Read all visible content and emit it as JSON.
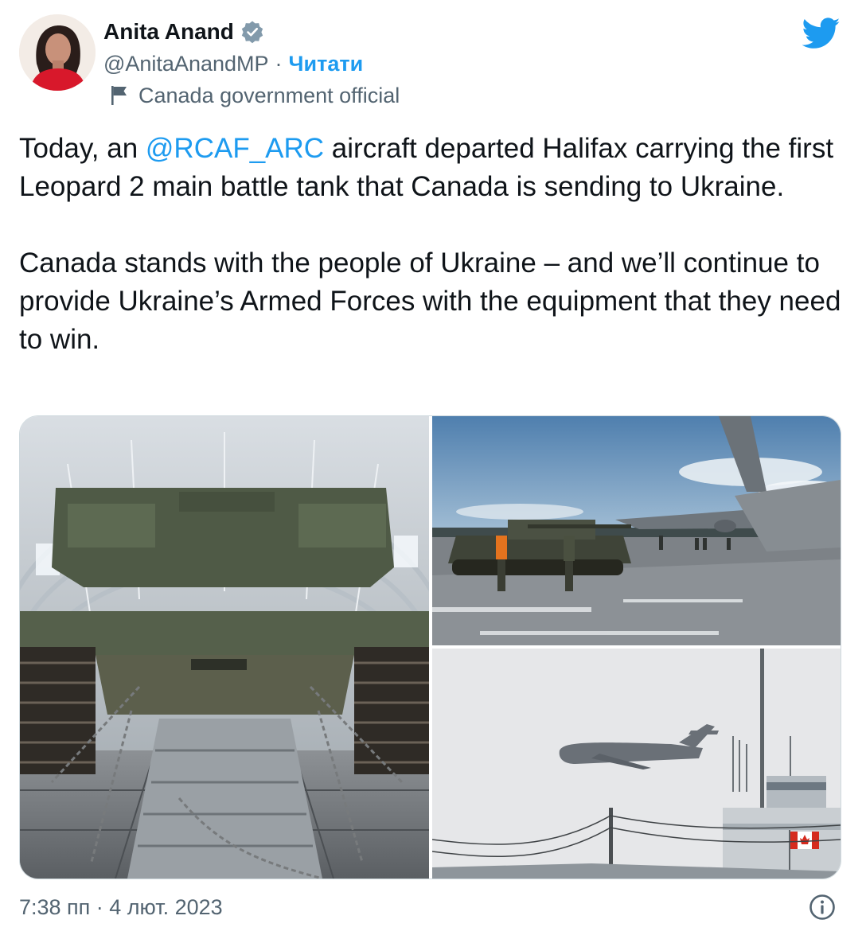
{
  "author": {
    "display_name": "Anita Anand",
    "handle": "@AnitaAnandMP",
    "separator": "·",
    "follow_label": "Читати",
    "label": "Canada government official",
    "verified": true
  },
  "tweet": {
    "paragraphs": [
      {
        "before": "Today, an ",
        "mention": "@RCAF_ARC",
        "after": " aircraft departed Halifax carrying the first Leopard 2 main battle tank that Canada is sending to Ukraine."
      },
      {
        "text": "Canada stands with the people of Ukraine – and we’ll continue to provide Ukraine’s Armed Forces with the equipment that they need to win."
      }
    ],
    "photos": [
      {
        "name": "tank-inside-aircraft-photo",
        "depicts": "Leopard 2 tank chained inside aircraft cargo hold"
      },
      {
        "name": "tank-on-tarmac-photo",
        "depicts": "Leopard 2 tank on airfield next to cargo aircraft"
      },
      {
        "name": "aircraft-takeoff-photo",
        "depicts": "Cargo aircraft taking off past control tower with Canadian flag"
      }
    ]
  },
  "footer": {
    "timestamp": "7:38 пп · 4 лют. 2023"
  },
  "icons": {
    "verified": "verified-badge-icon",
    "flag": "flag-icon",
    "logo": "twitter-bird-icon",
    "info": "info-icon"
  },
  "colors": {
    "accent": "#1d9bf0",
    "text": "#0f1419",
    "secondary": "#536471",
    "border": "#cfd9de"
  }
}
